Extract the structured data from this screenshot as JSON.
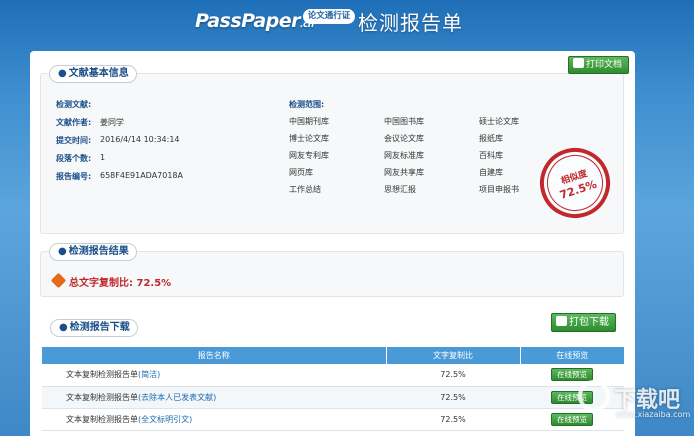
{
  "header": {
    "logo_main": "PassPaper",
    "logo_suffix": ".cn",
    "logo_badge": "论文通行证",
    "title": "检测报告单"
  },
  "doc_info": {
    "section_title": "文献基本信息",
    "print_button": "打印文档",
    "fields": [
      {
        "label": "检测文献:",
        "value": ""
      },
      {
        "label": "文献作者:",
        "value": "姜同学"
      },
      {
        "label": "提交时间:",
        "value": "2016/4/14 10:34:14"
      },
      {
        "label": "段落个数:",
        "value": "1"
      },
      {
        "label": "报告编号:",
        "value": "658F4E91ADA7018A"
      }
    ],
    "scope_label": "检测范围:",
    "scope_columns": [
      [
        "中国期刊库",
        "博士论文库",
        "网友专利库",
        "网页库",
        "工作总结"
      ],
      [
        "中国图书库",
        "会议论文库",
        "网友标准库",
        "网友共享库",
        "思想汇报"
      ],
      [
        "硕士论文库",
        "报纸库",
        "百科库",
        "自建库",
        "项目申报书"
      ]
    ],
    "stamp_top": "相似度",
    "stamp_value": "72.5%"
  },
  "result": {
    "section_title": "检测报告结果",
    "text": "总文字复制比: 72.5%"
  },
  "download": {
    "section_title": "检测报告下载",
    "pack_button": "打包下载",
    "columns": [
      "报告名称",
      "文字复制比",
      "在线预览"
    ],
    "rows": [
      {
        "name": "文本复制检测报告单",
        "variant": "(简洁)",
        "rate": "72.5%",
        "action": "在线预览"
      },
      {
        "name": "文本复制检测报告单",
        "variant": "(去除本人已发表文献)",
        "rate": "72.5%",
        "action": "在线预览"
      },
      {
        "name": "文本复制检测报告单",
        "variant": "(全文标明引文)",
        "rate": "72.5%",
        "action": "在线预览"
      }
    ]
  },
  "watermark": {
    "text": "下载吧",
    "url": "www.xiazaiba.com"
  },
  "colors": {
    "accent_blue": "#1b4f8a",
    "table_header": "#4a9ad8",
    "stamp_red": "#c0282d",
    "button_green": "#2e8b2e"
  }
}
